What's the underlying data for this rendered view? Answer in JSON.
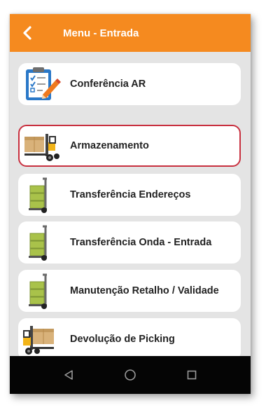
{
  "appbar": {
    "title": "Menu - Entrada",
    "back_icon": "chevron-left-icon",
    "color": "#f58a1f"
  },
  "menu": {
    "items": [
      {
        "label": "Conferência AR",
        "icon": "clipboard-checklist-icon",
        "selected": false
      },
      {
        "label": "Armazenamento",
        "icon": "forklift-boxes-icon",
        "selected": true
      },
      {
        "label": "Transferência Endereços",
        "icon": "hand-truck-icon",
        "selected": false
      },
      {
        "label": "Transferência Onda - Entrada",
        "icon": "hand-truck-icon",
        "selected": false
      },
      {
        "label": "Manutenção Retalho / Validade",
        "icon": "hand-truck-icon",
        "selected": false
      },
      {
        "label": "Devolução de Picking",
        "icon": "forklift-boxes-icon",
        "selected": false
      }
    ],
    "selected_border_color": "#c8303f"
  },
  "navbar": {
    "buttons": [
      "back-triangle-icon",
      "home-circle-icon",
      "recents-square-icon"
    ]
  }
}
